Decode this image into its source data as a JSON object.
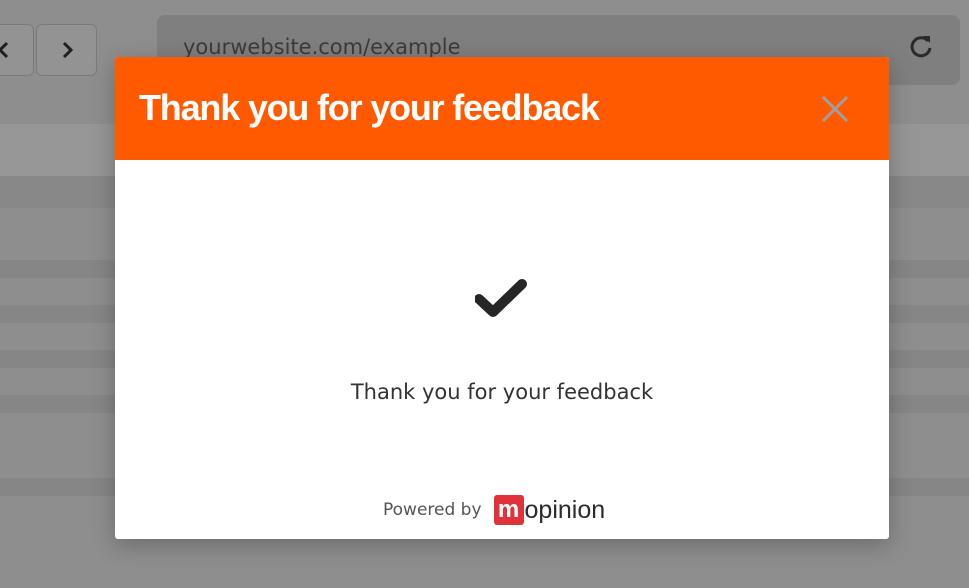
{
  "browser": {
    "url": "yourwebsite.com/example",
    "back_icon": "chevron-left-icon",
    "forward_icon": "chevron-right-icon",
    "reload_icon": "reload-icon"
  },
  "modal": {
    "title": "Thank you for your feedback",
    "close_icon": "close-icon",
    "check_icon": "checkmark-icon",
    "message": "Thank you for your feedback",
    "powered_by": "Powered by",
    "brand_initial": "m",
    "brand_name": "opinion"
  },
  "colors": {
    "header": "#ff5a00",
    "overlay": "#8e8e8e",
    "brand": "#e0323b"
  }
}
